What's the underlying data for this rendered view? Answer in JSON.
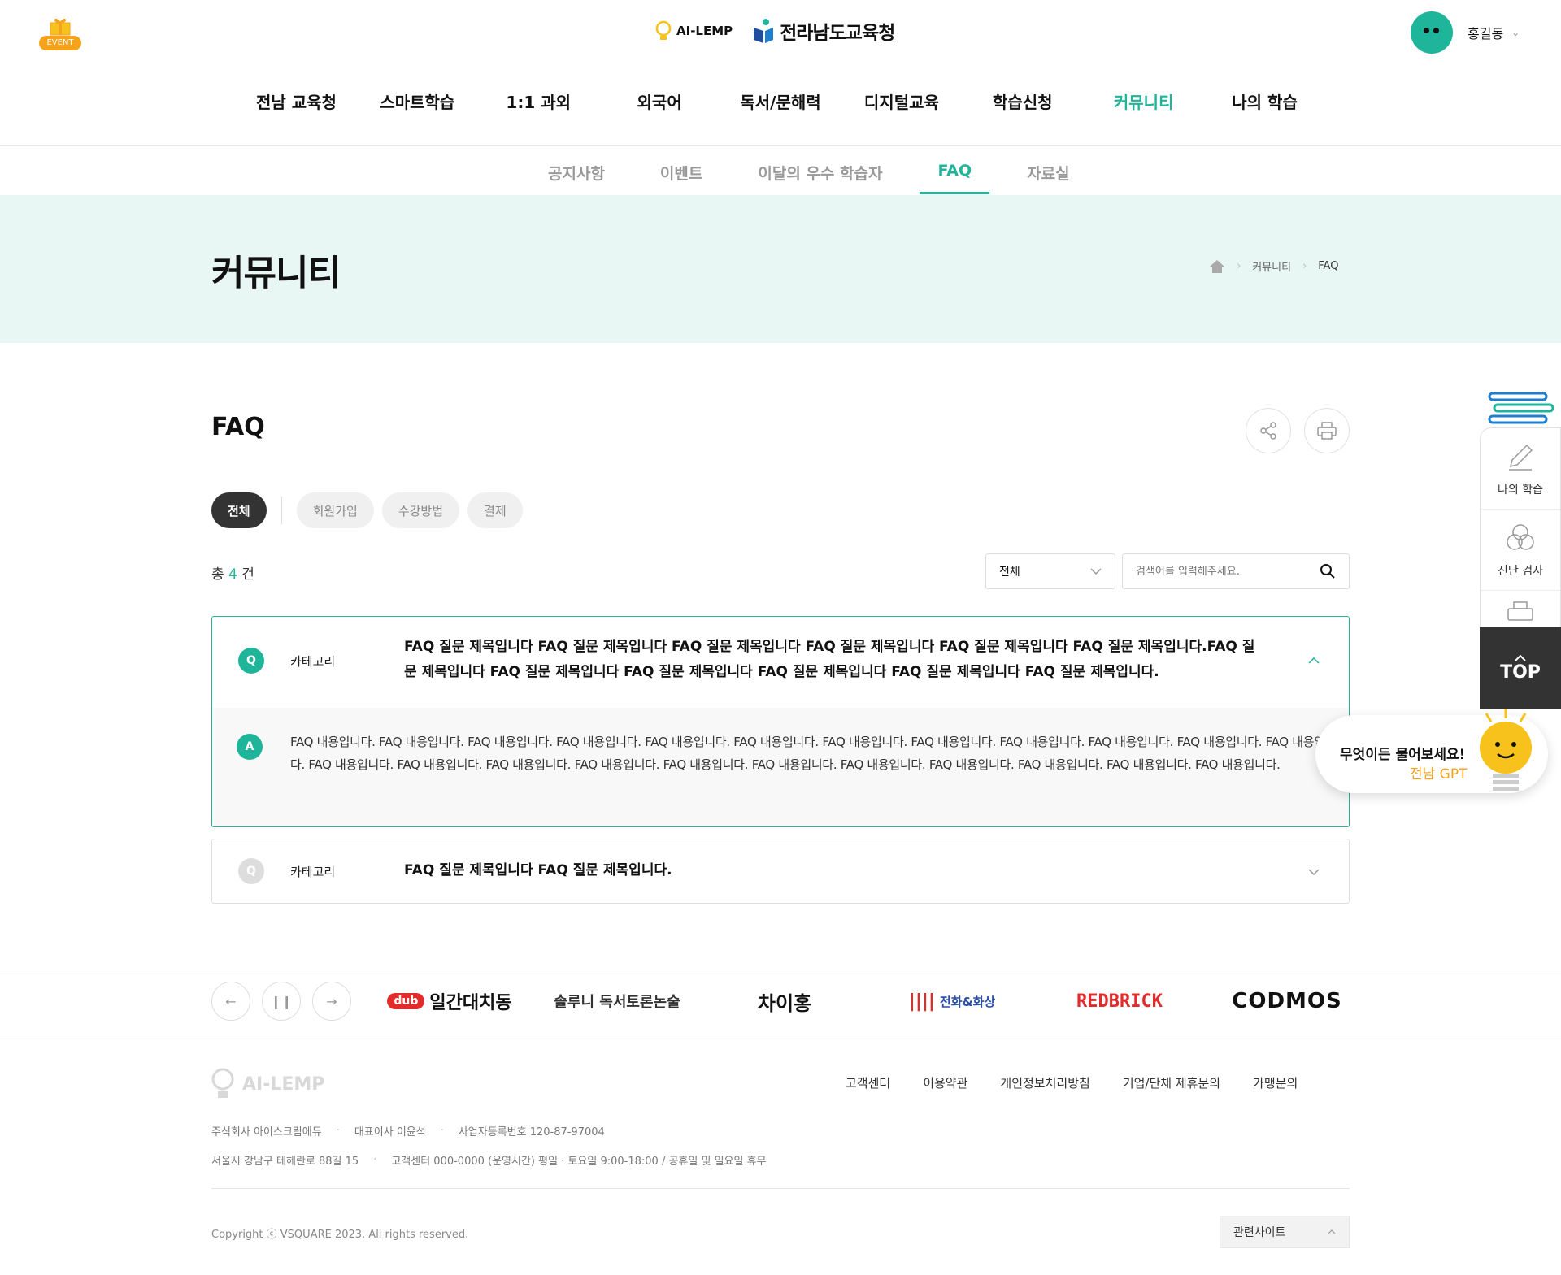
{
  "header": {
    "event_label": "EVENT",
    "logo_ailemp": "AI-LEMP",
    "logo_office": "전라남도교육청",
    "user_name": "홍길동",
    "accent": "#1fb59a"
  },
  "gnb": [
    "전남 교육청",
    "스마트학습",
    "1:1 과외",
    "외국어",
    "독서/문해력",
    "디지털교육",
    "학습신청",
    "커뮤니티",
    "나의 학습"
  ],
  "lnb": [
    "공지사항",
    "이벤트",
    "이달의 우수 학습자",
    "FAQ",
    "자료실"
  ],
  "page": {
    "title": "커뮤니티",
    "breadcrumb": [
      "커뮤니티",
      "FAQ"
    ],
    "section_title": "FAQ"
  },
  "filters": [
    "전체",
    "회원가입",
    "수강방법",
    "결제"
  ],
  "total": {
    "prefix": "총",
    "count": "4",
    "suffix": "건"
  },
  "search": {
    "select_value": "전체",
    "placeholder": "검색어를 입력해주세요."
  },
  "faq": [
    {
      "q_mark": "Q",
      "category": "카테고리",
      "question": "FAQ 질문 제목입니다 FAQ 질문 제목입니다 FAQ 질문 제목입니다 FAQ 질문 제목입니다 FAQ 질문 제목입니다 FAQ 질문 제목입니다.FAQ 질문 제목입니다 FAQ 질문 제목입니다 FAQ 질문 제목입니다 FAQ 질문 제목입니다 FAQ 질문 제목입니다 FAQ 질문 제목입니다.",
      "a_mark": "A",
      "answer": "FAQ 내용입니다. FAQ 내용입니다. FAQ 내용입니다. FAQ 내용입니다. FAQ 내용입니다. FAQ 내용입니다. FAQ 내용입니다. FAQ 내용입니다. FAQ 내용입니다. FAQ 내용입니다. FAQ 내용입니다. FAQ 내용입니다. FAQ 내용입니다. FAQ 내용입니다. FAQ 내용입니다. FAQ 내용입니다. FAQ 내용입니다. FAQ 내용입니다. FAQ 내용입니다. FAQ 내용입니다. FAQ 내용입니다. FAQ 내용입니다. FAQ 내용입니다.",
      "expanded": true
    },
    {
      "q_mark": "Q",
      "category": "카테고리",
      "question": "FAQ 질문 제목입니다 FAQ 질문 제목입니다.",
      "expanded": false
    }
  ],
  "partners": [
    "일간대치동",
    "솔루니 독서토론논술",
    "차이홍",
    "전화&화상",
    "REDBRICK",
    "CODMOS"
  ],
  "footer": {
    "logo": "AI-LEMP",
    "links": [
      "고객센터",
      "이용약관",
      "개인정보처리방침",
      "기업/단체 제휴문의",
      "가맹문의"
    ],
    "info1": [
      "주식회사 아이스크림에듀",
      "대표이사 이윤석",
      "사업자등록번호 120-87-97004"
    ],
    "info2": [
      "서울시 강남구 테헤란로 88길 15",
      "고객센터 000-0000 (운영시간) 평일 · 토요일 9:00-18:00 / 공휴일 및 일요일 휴무"
    ],
    "copyright": "Copyright ⓒ VSQUARE 2023. All rights reserved.",
    "related": "관련사이트"
  },
  "quick": {
    "items": [
      "나의 학습",
      "진단 검사"
    ],
    "top": "TOP",
    "gpt_line1": "무엇이든 물어보세요!",
    "gpt_line2": "전남 GPT"
  }
}
